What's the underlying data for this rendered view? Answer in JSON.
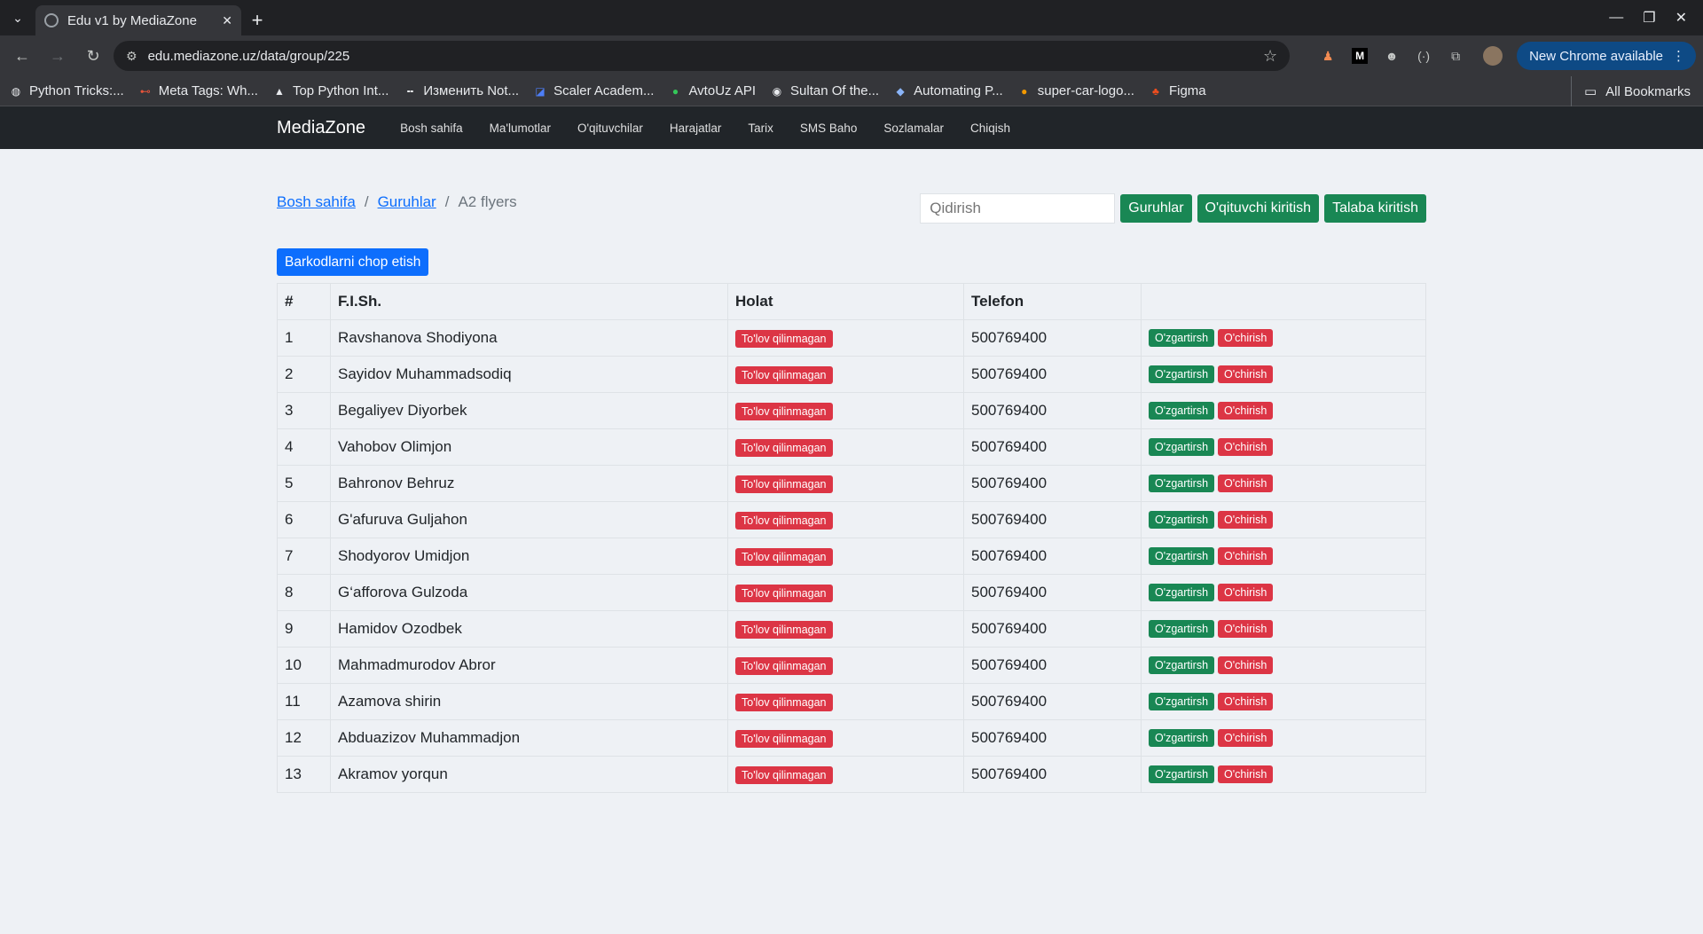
{
  "browser": {
    "tab_title": "Edu v1 by MediaZone",
    "url": "edu.mediazone.uz/data/group/225",
    "update_label": "New Chrome available",
    "bookmarks": [
      {
        "label": "Python Tricks:...",
        "icon": "globe-icon"
      },
      {
        "label": "Meta Tags: Wh...",
        "icon": "meta-tags-icon"
      },
      {
        "label": "Top Python Int...",
        "icon": "mountain-icon"
      },
      {
        "label": "Изменить Not...",
        "icon": "dash-icon"
      },
      {
        "label": "Scaler Academ...",
        "icon": "scaler-icon"
      },
      {
        "label": "AvtoUz API",
        "icon": "avto-icon"
      },
      {
        "label": "Sultan Of the...",
        "icon": "sultan-icon"
      },
      {
        "label": "Automating P...",
        "icon": "cube-icon"
      },
      {
        "label": "super-car-logo...",
        "icon": "car-logo-icon"
      },
      {
        "label": "Figma",
        "icon": "figma-icon"
      }
    ],
    "all_bookmarks_label": "All Bookmarks"
  },
  "app": {
    "brand": "MediaZone",
    "nav": [
      "Bosh sahifa",
      "Ma'lumotlar",
      "O'qituvchilar",
      "Harajatlar",
      "Tarix",
      "SMS Baho",
      "Sozlamalar",
      "Chiqish"
    ]
  },
  "breadcrumb": {
    "home": "Bosh sahifa",
    "groups": "Guruhlar",
    "current": "A2 flyers",
    "separator": "/"
  },
  "search": {
    "placeholder": "Qidirish"
  },
  "actions": {
    "groups": "Guruhlar",
    "add_teacher": "O'qituvchi kiritish",
    "add_student": "Talaba kiritish"
  },
  "print_barcodes": "Barkodlarni chop etish",
  "table": {
    "headers": [
      "#",
      "F.I.Sh.",
      "Holat",
      "Telefon",
      ""
    ],
    "edit_label": "O'zgartirsh",
    "delete_label": "O'chirish",
    "rows": [
      {
        "n": "1",
        "name": "Ravshanova Shodiyona",
        "status": "To'lov qilinmagan",
        "phone": "500769400"
      },
      {
        "n": "2",
        "name": "Sayidov Muhammadsodiq",
        "status": "To'lov qilinmagan",
        "phone": "500769400"
      },
      {
        "n": "3",
        "name": "Begaliyev Diyorbek",
        "status": "To'lov qilinmagan",
        "phone": "500769400"
      },
      {
        "n": "4",
        "name": "Vahobov Olimjon",
        "status": "To'lov qilinmagan",
        "phone": "500769400"
      },
      {
        "n": "5",
        "name": "Bahronov Behruz",
        "status": "To'lov qilinmagan",
        "phone": "500769400"
      },
      {
        "n": "6",
        "name": "G'afuruva Guljahon",
        "status": "To'lov qilinmagan",
        "phone": "500769400"
      },
      {
        "n": "7",
        "name": "Shodyorov Umidjon",
        "status": "To'lov qilinmagan",
        "phone": "500769400"
      },
      {
        "n": "8",
        "name": "G‘afforova Gulzoda",
        "status": "To'lov qilinmagan",
        "phone": "500769400"
      },
      {
        "n": "9",
        "name": "Hamidov Ozodbek",
        "status": "To'lov qilinmagan",
        "phone": "500769400"
      },
      {
        "n": "10",
        "name": "Mahmadmurodov Abror",
        "status": "To'lov qilinmagan",
        "phone": "500769400"
      },
      {
        "n": "11",
        "name": "Azamova shirin",
        "status": "To'lov qilinmagan",
        "phone": "500769400"
      },
      {
        "n": "12",
        "name": "Abduazizov Muhammadjon",
        "status": "To'lov qilinmagan",
        "phone": "500769400"
      },
      {
        "n": "13",
        "name": "Akramov yorqun",
        "status": "To'lov qilinmagan",
        "phone": "500769400"
      }
    ]
  },
  "colors": {
    "success": "#198754",
    "danger": "#dc3545",
    "primary": "#0d6efd",
    "navbar": "#212529"
  }
}
